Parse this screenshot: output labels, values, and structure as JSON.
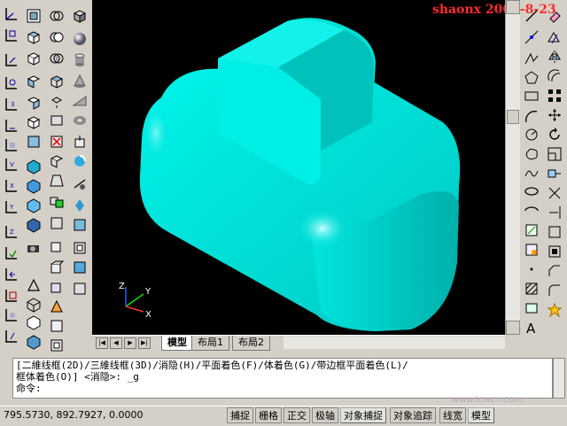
{
  "watermark": "shaonx 2009-8-23",
  "tabs": {
    "model": "模型",
    "layout1": "布局1",
    "layout2": "布局2"
  },
  "command": {
    "line1": "[二維线框(2D)/三維线框(3D)/消隐(H)/平面着色(F)/体着色(G)/带边框平面着色(L)/",
    "line2": "框体着色(O)] <消隐>: _g",
    "prompt": "命令:"
  },
  "status": {
    "coords": "795.5730, 892.7927, 0.0000",
    "snap": "捕捉",
    "grid": "栅格",
    "ortho": "正交",
    "polar": "极轴",
    "osnap": "对象捕捉",
    "otrack": "对象追踪",
    "lwt": "线宽",
    "model": "模型"
  },
  "site_mark": "www.lcwcn.com",
  "ucs": {
    "x": "X",
    "y": "Y",
    "z": "Z"
  },
  "colors": {
    "solid": "#00e0d8",
    "viewport": "#000000",
    "watermark": "#ff2a2a"
  }
}
